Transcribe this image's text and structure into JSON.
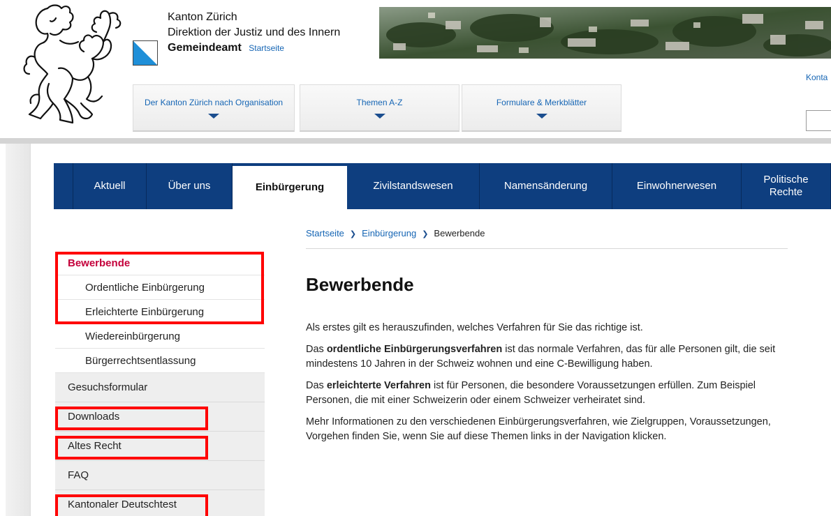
{
  "header": {
    "org_line1": "Kanton Zürich",
    "org_line2": "Direktion der Justiz und des Innern",
    "office": "Gemeindeamt",
    "startseite": "Startseite",
    "kontakt": "Konta",
    "mega_menu": [
      {
        "label": "Der Kanton Zürich nach Organisation"
      },
      {
        "label": "Themen A-Z"
      },
      {
        "label": "Formulare & Merkblätter"
      }
    ]
  },
  "mainnav": {
    "tabs": [
      {
        "label": "Aktuell"
      },
      {
        "label": "Über uns"
      },
      {
        "label": "Einbürgerung",
        "active": true
      },
      {
        "label": "Zivilstandswesen"
      },
      {
        "label": "Namensänderung"
      },
      {
        "label": "Einwohnerwesen"
      },
      {
        "label": "Politische Rechte"
      }
    ]
  },
  "breadcrumb": {
    "items": [
      "Startseite",
      "Einbürgerung",
      "Bewerbende"
    ]
  },
  "sidebar": {
    "items": [
      {
        "label": "Bewerbende"
      },
      {
        "label": "Ordentliche Einbürgerung"
      },
      {
        "label": "Erleichterte Einbürgerung"
      },
      {
        "label": "Wiedereinbürgerung"
      },
      {
        "label": "Bürgerrechtsentlassung"
      },
      {
        "label": "Gesuchsformular"
      },
      {
        "label": "Downloads"
      },
      {
        "label": "Altes Recht"
      },
      {
        "label": "FAQ"
      },
      {
        "label": "Kantonaler Deutschtest"
      }
    ]
  },
  "content": {
    "title": "Bewerbende",
    "p1": "Als erstes gilt es herauszufinden, welches Verfahren für Sie das richtige ist.",
    "p2_pre": "Das ",
    "p2_bold": "ordentliche Einbürgerungsverfahren",
    "p2_post": " ist das normale Verfahren, das für alle Personen gilt, die seit mindestens 10 Jahren in der Schweiz wohnen und eine C-Bewilligung haben.",
    "p3_pre": "Das ",
    "p3_bold": "erleichterte Verfahren",
    "p3_post": " ist für Personen, die besondere Voraussetzungen erfüllen. Zum Beispiel Personen, die mit einer Schweizerin oder einem Schweizer verheiratet sind.",
    "p4": "Mehr Informationen zu den verschiedenen Einbürgerungsverfahren, wie Zielgruppen, Voraussetzungen, Vorgehen finden Sie, wenn Sie auf diese Themen links in der Navigation klicken."
  },
  "colors": {
    "nav_blue": "#0e3e7f",
    "link_blue": "#1565b4",
    "current_red": "#c4003b",
    "highlight_red": "#ff0000"
  }
}
